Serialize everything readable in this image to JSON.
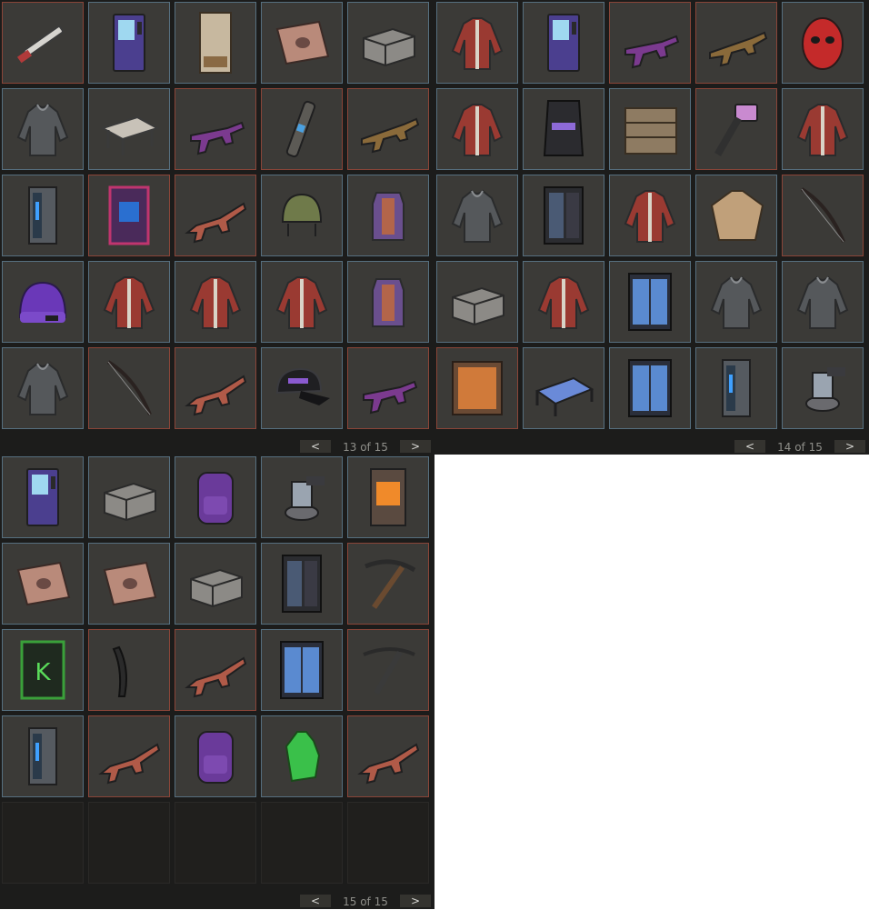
{
  "panels": [
    {
      "page_label": "13 of 15",
      "prev_label": "<",
      "next_label": ">",
      "items": [
        {
          "icon": "rifle-barrel-icon",
          "rarity": "red"
        },
        {
          "icon": "vending-machine-icon",
          "rarity": "blue"
        },
        {
          "icon": "wooden-door-sign-icon",
          "rarity": "blue"
        },
        {
          "icon": "rug-icon",
          "rarity": "blue"
        },
        {
          "icon": "storage-box-icon",
          "rarity": "blue"
        },
        {
          "icon": "hoodie-icon",
          "rarity": "blue"
        },
        {
          "icon": "table-icon",
          "rarity": "blue"
        },
        {
          "icon": "smg-icon",
          "rarity": "red"
        },
        {
          "icon": "rocket-launcher-icon",
          "rarity": "red"
        },
        {
          "icon": "thompson-icon",
          "rarity": "red"
        },
        {
          "icon": "metal-door-icon",
          "rarity": "blue"
        },
        {
          "icon": "arcade-door-icon",
          "rarity": "red"
        },
        {
          "icon": "assault-rifle-icon",
          "rarity": "red"
        },
        {
          "icon": "helmet-icon",
          "rarity": "blue"
        },
        {
          "icon": "chest-plate-icon",
          "rarity": "blue"
        },
        {
          "icon": "beanie-icon",
          "rarity": "blue"
        },
        {
          "icon": "jacket-icon",
          "rarity": "blue"
        },
        {
          "icon": "jacket-icon",
          "rarity": "blue"
        },
        {
          "icon": "jacket-icon",
          "rarity": "blue"
        },
        {
          "icon": "chest-plate-icon",
          "rarity": "blue"
        },
        {
          "icon": "hoodie-icon",
          "rarity": "blue"
        },
        {
          "icon": "bow-icon",
          "rarity": "red"
        },
        {
          "icon": "assault-rifle-icon",
          "rarity": "red"
        },
        {
          "icon": "cap-icon",
          "rarity": "blue"
        },
        {
          "icon": "smg-icon",
          "rarity": "red"
        }
      ]
    },
    {
      "page_label": "14 of 15",
      "prev_label": "<",
      "next_label": ">",
      "items": [
        {
          "icon": "jacket-icon",
          "rarity": "blue"
        },
        {
          "icon": "vending-machine-icon",
          "rarity": "blue"
        },
        {
          "icon": "smg-icon",
          "rarity": "red"
        },
        {
          "icon": "thompson-icon",
          "rarity": "red"
        },
        {
          "icon": "mask-icon",
          "rarity": "blue"
        },
        {
          "icon": "jacket-icon",
          "rarity": "blue"
        },
        {
          "icon": "sleeping-bag-icon",
          "rarity": "blue"
        },
        {
          "icon": "wooden-barricade-icon",
          "rarity": "blue"
        },
        {
          "icon": "hammer-icon",
          "rarity": "red"
        },
        {
          "icon": "jacket-icon",
          "rarity": "blue"
        },
        {
          "icon": "hoodie-icon",
          "rarity": "blue"
        },
        {
          "icon": "locker-icon",
          "rarity": "blue"
        },
        {
          "icon": "jacket-icon",
          "rarity": "blue"
        },
        {
          "icon": "poncho-icon",
          "rarity": "blue"
        },
        {
          "icon": "bow-icon",
          "rarity": "red"
        },
        {
          "icon": "storage-box-icon",
          "rarity": "blue"
        },
        {
          "icon": "jacket-icon",
          "rarity": "blue"
        },
        {
          "icon": "double-door-icon",
          "rarity": "blue"
        },
        {
          "icon": "hoodie-icon",
          "rarity": "blue"
        },
        {
          "icon": "hoodie-icon",
          "rarity": "blue"
        },
        {
          "icon": "picture-frame-icon",
          "rarity": "red"
        },
        {
          "icon": "bed-icon",
          "rarity": "blue"
        },
        {
          "icon": "double-door-icon",
          "rarity": "blue"
        },
        {
          "icon": "metal-door-icon",
          "rarity": "blue"
        },
        {
          "icon": "turret-icon",
          "rarity": "blue"
        }
      ]
    },
    {
      "page_label": "15 of 15",
      "prev_label": "<",
      "next_label": ">",
      "items": [
        {
          "icon": "vending-machine-icon",
          "rarity": "blue"
        },
        {
          "icon": "storage-box-icon",
          "rarity": "blue"
        },
        {
          "icon": "backpack-icon",
          "rarity": "blue"
        },
        {
          "icon": "turret-icon",
          "rarity": "blue"
        },
        {
          "icon": "furnace-icon",
          "rarity": "blue"
        },
        {
          "icon": "rug-icon",
          "rarity": "blue"
        },
        {
          "icon": "rug-icon",
          "rarity": "blue"
        },
        {
          "icon": "storage-box-icon",
          "rarity": "blue"
        },
        {
          "icon": "locker-icon",
          "rarity": "blue"
        },
        {
          "icon": "pickaxe-icon",
          "rarity": "red"
        },
        {
          "icon": "garage-door-icon",
          "rarity": "blue"
        },
        {
          "icon": "machete-icon",
          "rarity": "red"
        },
        {
          "icon": "assault-rifle-icon",
          "rarity": "red"
        },
        {
          "icon": "double-door-icon",
          "rarity": "blue"
        },
        {
          "icon": "crossbow-icon",
          "rarity": "red"
        },
        {
          "icon": "metal-door-icon",
          "rarity": "blue"
        },
        {
          "icon": "assault-rifle-icon",
          "rarity": "red"
        },
        {
          "icon": "backpack-icon",
          "rarity": "blue"
        },
        {
          "icon": "gloves-icon",
          "rarity": "blue"
        },
        {
          "icon": "assault-rifle-icon",
          "rarity": "red"
        },
        {
          "icon": "empty",
          "rarity": "empty"
        },
        {
          "icon": "empty",
          "rarity": "empty"
        },
        {
          "icon": "empty",
          "rarity": "empty"
        },
        {
          "icon": "empty",
          "rarity": "empty"
        },
        {
          "icon": "empty",
          "rarity": "empty"
        }
      ]
    }
  ]
}
